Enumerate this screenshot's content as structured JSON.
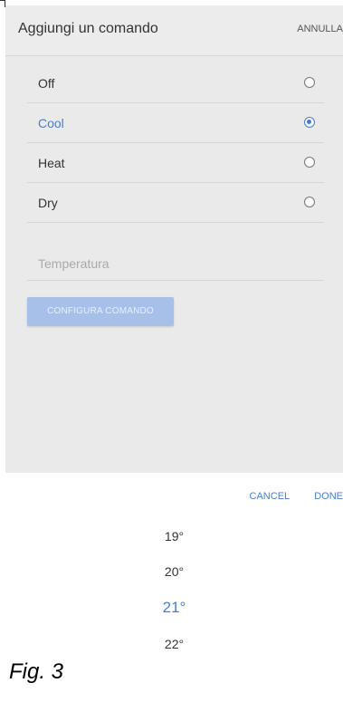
{
  "header": {
    "title": "Aggiungi un comando",
    "cancel_label": "ANNULLA"
  },
  "options": [
    {
      "label": "Off",
      "selected": false
    },
    {
      "label": "Cool",
      "selected": true
    },
    {
      "label": "Heat",
      "selected": false
    },
    {
      "label": "Dry",
      "selected": false
    }
  ],
  "temperature": {
    "placeholder": "Temperatura"
  },
  "configure_button": {
    "label": "CONFIGURA COMANDO"
  },
  "picker": {
    "cancel_label": "CANCEL",
    "done_label": "DONE",
    "values": [
      "19°",
      "20°",
      "21°",
      "22°"
    ],
    "selected_index": 2
  },
  "caption": "Fig. 3",
  "colors": {
    "accent": "#4a7ec9",
    "overlay": "#eaeaea",
    "button_disabled": "#a6c0ea"
  }
}
